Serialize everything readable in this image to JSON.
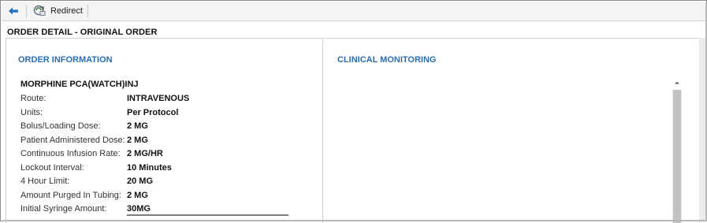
{
  "toolbar": {
    "back_icon": "back-arrow-icon",
    "redirect_icon": "redirect-icon",
    "redirect_label": "Redirect"
  },
  "page": {
    "title": "ORDER DETAIL - ORIGINAL ORDER"
  },
  "order_information": {
    "heading": "ORDER INFORMATION",
    "drug_name": "MORPHINE PCA(WATCH)INJ",
    "rows": [
      {
        "label": "Route:",
        "value": "INTRAVENOUS"
      },
      {
        "label": "Units:",
        "value": "Per Protocol"
      },
      {
        "label": "Bolus/Loading Dose:",
        "value": "2 MG"
      },
      {
        "label": "Patient Administered Dose:",
        "value": "2 MG"
      },
      {
        "label": "Continuous Infusion Rate:",
        "value": "2 MG/HR"
      },
      {
        "label": "Lockout Interval:",
        "value": "10 Minutes"
      },
      {
        "label": "4 Hour Limit:",
        "value": "20 MG"
      },
      {
        "label": "Amount Purged In Tubing:",
        "value": "2 MG"
      },
      {
        "label": "Initial Syringe Amount:",
        "value": "30MG"
      }
    ]
  },
  "clinical_monitoring": {
    "heading": "CLINICAL MONITORING"
  },
  "colors": {
    "section_heading": "#2a6eb2",
    "back_arrow": "#1f6fc4"
  }
}
